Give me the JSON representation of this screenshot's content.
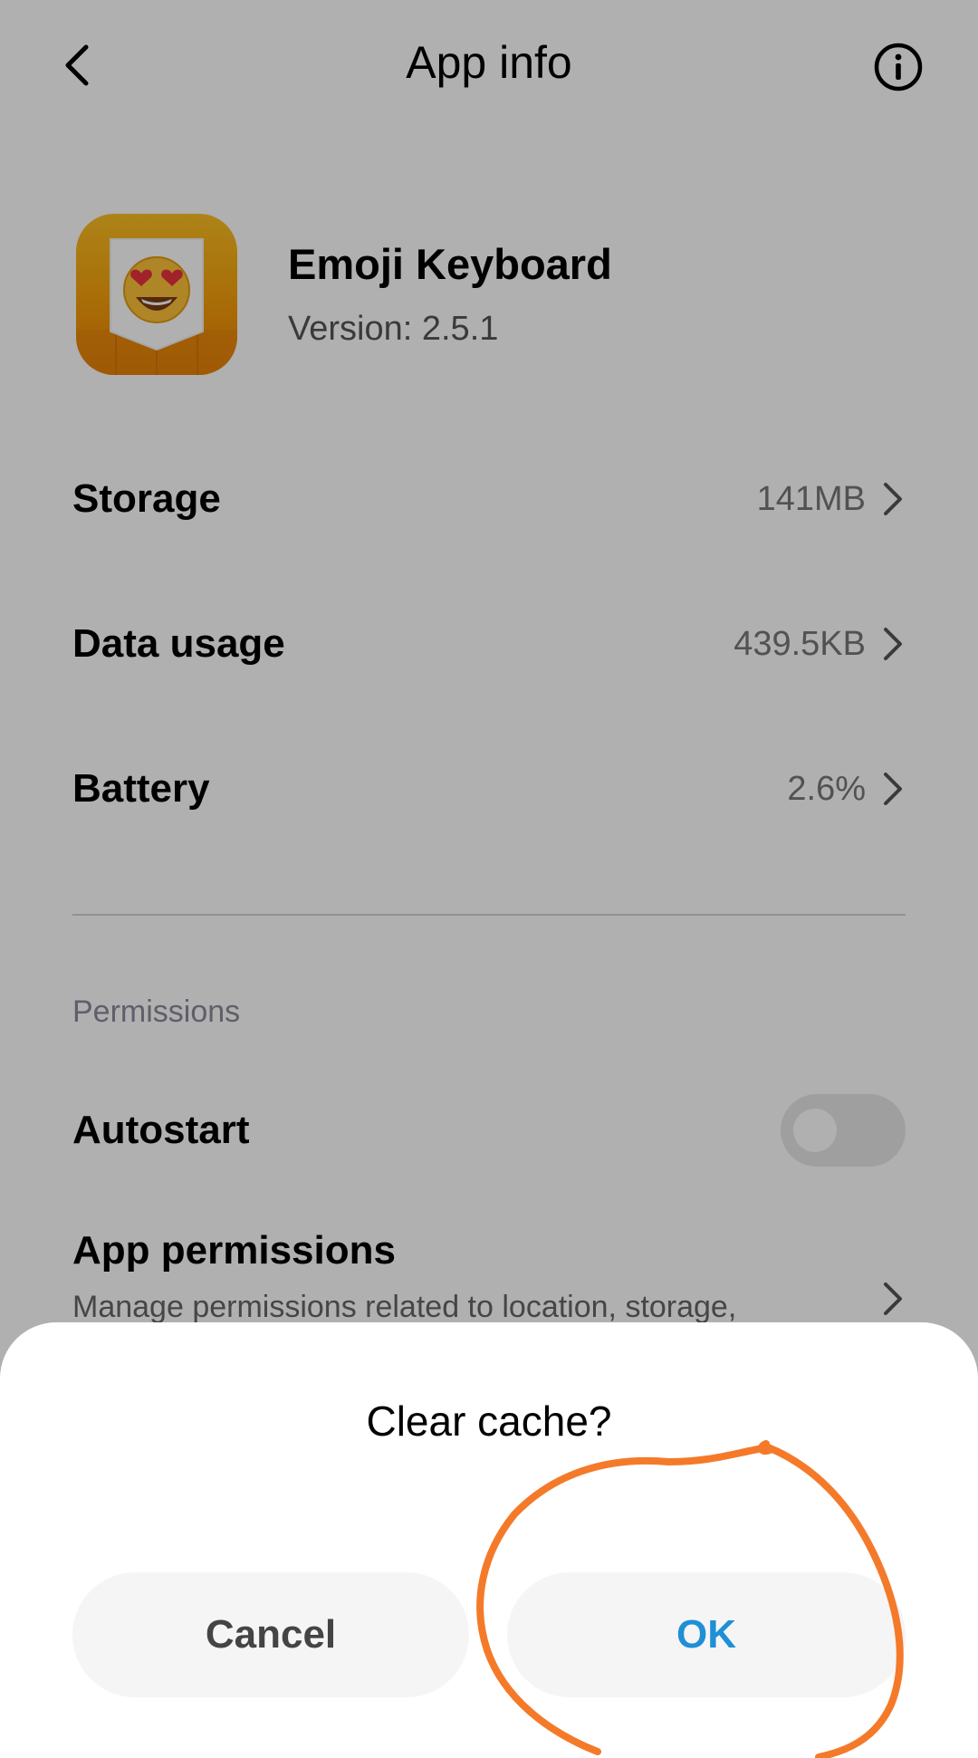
{
  "header": {
    "title": "App info",
    "back_icon": "chevron-left-icon",
    "info_icon": "info-circle-icon"
  },
  "app": {
    "name": "Emoji Keyboard",
    "version": "Version: 2.5.1",
    "icon": "emoji-heart-eyes-icon"
  },
  "rows": [
    {
      "label": "Storage",
      "value": "141MB"
    },
    {
      "label": "Data usage",
      "value": "439.5KB"
    },
    {
      "label": "Battery",
      "value": "2.6%"
    }
  ],
  "permissions": {
    "section_label": "Permissions",
    "autostart_label": "Autostart",
    "autostart_on": false,
    "app_permissions_title": "App permissions",
    "app_permissions_subtitle": "Manage permissions related to location, storage,"
  },
  "dialog": {
    "title": "Clear cache?",
    "cancel_label": "Cancel",
    "ok_label": "OK"
  },
  "colors": {
    "accent": "#1f8fd6",
    "annotation": "#f47a2a",
    "app_icon": "#f59e0b"
  }
}
